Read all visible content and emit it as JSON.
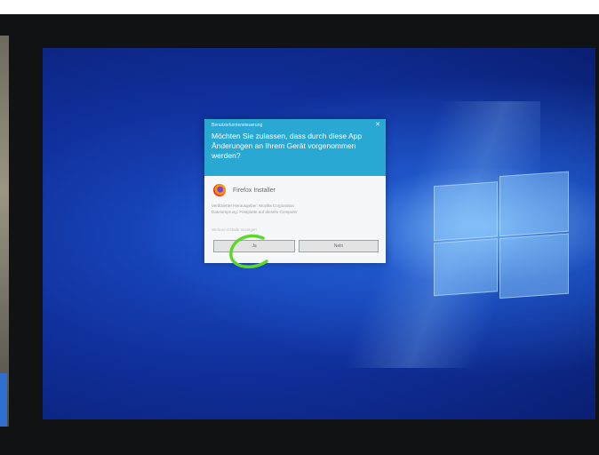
{
  "dialog": {
    "caption": "Benutzerkontensteuerung",
    "question": "Möchten Sie zulassen, dass durch diese App Änderungen an Ihrem Gerät vorgenommen werden?",
    "app_name": "Firefox Installer",
    "details": [
      "Verifizierter Herausgeber: Mozilla Corporation",
      "Dateiursprung: Festplatte auf diesem Computer"
    ],
    "more_details": "Weitere Details anzeigen",
    "yes_label": "Ja",
    "no_label": "Nein",
    "close_glyph": "✕",
    "header_color": "#29a8d4"
  },
  "annotation": {
    "color": "#5ed62a",
    "shape": "circle-scribble"
  },
  "desktop": {
    "wallpaper": "windows-10-hero-blue"
  }
}
